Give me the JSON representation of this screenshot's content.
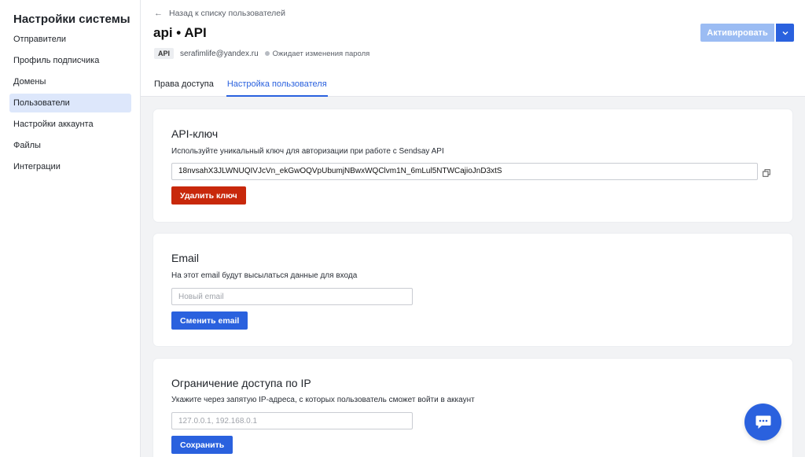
{
  "sidebar": {
    "title": "Настройки системы",
    "items": [
      {
        "label": "Отправители"
      },
      {
        "label": "Профиль подписчика"
      },
      {
        "label": "Домены"
      },
      {
        "label": "Пользователи"
      },
      {
        "label": "Настройки аккаунта"
      },
      {
        "label": "Файлы"
      },
      {
        "label": "Интеграции"
      }
    ],
    "active_index": 3
  },
  "header": {
    "back_label": "Назад к списку пользователей",
    "title": "api • API",
    "badge": "API",
    "email": "serafimlife@yandex.ru",
    "status": "Ожидает изменения пароля",
    "activate_label": "Активировать",
    "tabs": [
      {
        "label": "Права доступа"
      },
      {
        "label": "Настройка пользователя"
      }
    ],
    "active_tab": 1
  },
  "api_key_card": {
    "title": "API-ключ",
    "description": "Используйте уникальный ключ для авторизации при работе с Sendsay API",
    "key_value": "18nvsahX3JLWNUQIVJcVn_ekGwOQVpUbumjNBwxWQClvm1N_6mLul5NTWCajioJnD3xtS",
    "delete_label": "Удалить ключ"
  },
  "email_card": {
    "title": "Email",
    "description": "На этот email будут высылаться данные для входа",
    "placeholder": "Новый email",
    "button_label": "Сменить email"
  },
  "ip_card": {
    "title": "Ограничение доступа по IP",
    "description": "Укажите через запятую IP-адреса, с которых пользователь сможет войти в аккаунт",
    "placeholder": "127.0.0.1, 192.168.0.1",
    "button_label": "Сохранить"
  },
  "colors": {
    "accent": "#2a61de",
    "danger": "#c8280b",
    "activate_disabled": "#9bbcf3",
    "active_nav_bg": "#dde7fb"
  },
  "icons": {
    "back": "arrow-left-icon",
    "copy": "copy-icon",
    "dropdown": "chevron-down-icon",
    "chat": "chat-icon"
  }
}
